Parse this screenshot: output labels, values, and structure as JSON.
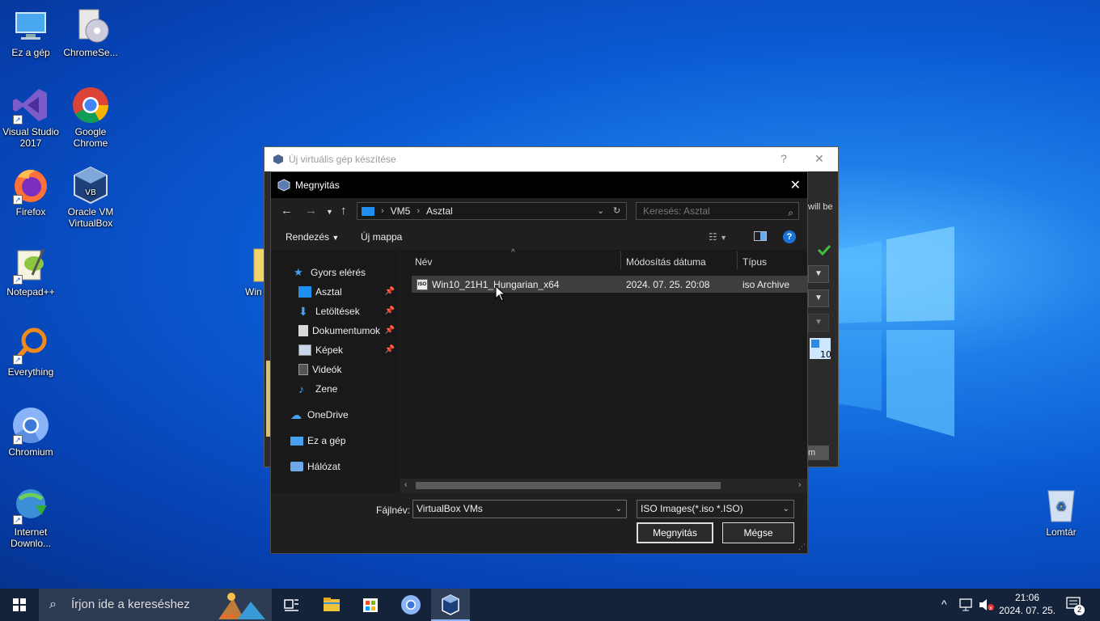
{
  "desktop": {
    "icons": [
      {
        "label": "Ez a gép",
        "icon": "this-pc-icon"
      },
      {
        "label": "ChromeSe...",
        "icon": "chrome-setup-icon"
      },
      {
        "label": "Visual Studio 2017",
        "icon": "visual-studio-icon"
      },
      {
        "label": "Google Chrome",
        "icon": "chrome-icon"
      },
      {
        "label": "Firefox",
        "icon": "firefox-icon"
      },
      {
        "label": "Oracle VM VirtualBox",
        "icon": "virtualbox-icon"
      },
      {
        "label": "Notepad++",
        "icon": "notepadpp-icon"
      },
      {
        "label": "Win",
        "icon": "folder-icon"
      },
      {
        "label": "Everything",
        "icon": "everything-icon"
      },
      {
        "label": "Chromium",
        "icon": "chromium-icon"
      },
      {
        "label": "Internet Downlo...",
        "icon": "idm-icon"
      },
      {
        "label": "Lomtár",
        "icon": "recycle-bin-icon"
      }
    ]
  },
  "parent_dialog": {
    "title": "Új virtuális gép készítése",
    "help": "?",
    "close": "✕",
    "side_text": "will be",
    "bottom_fragment": "m"
  },
  "open_dialog": {
    "title": "Megnyitás",
    "close": "✕",
    "breadcrumb": [
      "VM5",
      "Asztal"
    ],
    "search_placeholder": "Keresés: Asztal",
    "toolbar": {
      "organize": "Rendezés",
      "new_folder": "Új mappa",
      "help": "?"
    },
    "nav": {
      "quick_access": "Gyors elérés",
      "items": [
        {
          "label": "Asztal",
          "pinned": true,
          "icon": "desktop-folder-icon"
        },
        {
          "label": "Letöltések",
          "pinned": true,
          "icon": "downloads-icon"
        },
        {
          "label": "Dokumentumok",
          "pinned": true,
          "icon": "documents-icon"
        },
        {
          "label": "Képek",
          "pinned": true,
          "icon": "pictures-icon"
        },
        {
          "label": "Videók",
          "pinned": false,
          "icon": "videos-icon"
        },
        {
          "label": "Zene",
          "pinned": false,
          "icon": "music-icon"
        }
      ],
      "onedrive": "OneDrive",
      "this_pc": "Ez a gép",
      "network": "Hálózat"
    },
    "columns": [
      "Név",
      "Módosítás dátuma",
      "Típus"
    ],
    "files": [
      {
        "name": "Win10_21H1_Hungarian_x64",
        "date": "2024. 07. 25. 20:08",
        "type": "iso Archive",
        "icon_text": "ISO"
      }
    ],
    "filename_label": "Fájlnév:",
    "filename_value": "VirtualBox VMs",
    "filter_value": "ISO Images(*.iso *.ISO)",
    "open_button": "Megnyitás",
    "cancel_button": "Mégse"
  },
  "taskbar": {
    "search_placeholder": "Írjon ide a kereséshez",
    "apps": [
      "task-view-icon",
      "file-explorer-icon",
      "store-icon",
      "chromium-icon",
      "virtualbox-icon"
    ],
    "clock_time": "21:06",
    "clock_date": "2024. 07. 25.",
    "notification_count": "2"
  }
}
